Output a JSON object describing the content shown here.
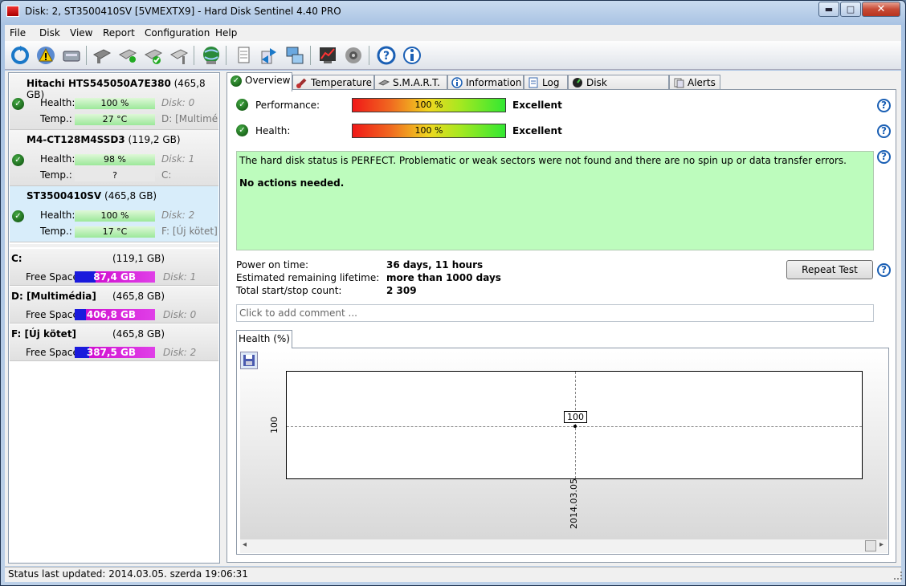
{
  "window": {
    "title": "Disk: 2, ST3500410SV [5VMEXTX9]  -  Hard Disk Sentinel 4.40 PRO",
    "controls": {
      "minimize": "▬",
      "maximize": "□",
      "close": "✕"
    }
  },
  "menu": [
    "File",
    "Disk",
    "View",
    "Report",
    "Configuration",
    "Help"
  ],
  "toolbar_icons": [
    "refresh-icon",
    "alert-icon",
    "disk-icon",
    "disk-gray-icon",
    "disk-check-icon",
    "disk-ok-icon",
    "disk-tool-icon",
    "globe-icon",
    "document-icon",
    "transfer-icon",
    "network-icon",
    "chart-icon",
    "speaker-icon",
    "help-icon",
    "info-icon"
  ],
  "disks": [
    {
      "name": "Hitachi HTS545050A7E380",
      "size": "(465,8 GB)",
      "health_label": "Health:",
      "health": "100 %",
      "health_pct": 100,
      "disk_no": "Disk: 0",
      "temp_label": "Temp.:",
      "temp": "27 °C",
      "volume": "D: [Multiméd"
    },
    {
      "name": "M4-CT128M4SSD3",
      "size": "(119,2 GB)",
      "health_label": "Health:",
      "health": "98 %",
      "health_pct": 98,
      "disk_no": "Disk: 1",
      "temp_label": "Temp.:",
      "temp": "?",
      "volume": "C:"
    },
    {
      "name": "ST3500410SV",
      "size": "(465,8 GB)",
      "health_label": "Health:",
      "health": "100 %",
      "health_pct": 100,
      "disk_no": "Disk: 2",
      "temp_label": "Temp.:",
      "temp": "17 °C",
      "volume": "F: [Új kötet]"
    }
  ],
  "volumes": [
    {
      "name": "C:",
      "size": "(119,1 GB)",
      "free_label": "Free Space",
      "free": "87,4 GB",
      "disk_no": "Disk: 1"
    },
    {
      "name": "D: [Multimédia]",
      "size": "(465,8 GB)",
      "free_label": "Free Space",
      "free": "406,8 GB",
      "disk_no": "Disk: 0"
    },
    {
      "name": "F: [Új kötet]",
      "size": "(465,8 GB)",
      "free_label": "Free Space",
      "free": "387,5 GB",
      "disk_no": "Disk: 2"
    }
  ],
  "tabs": [
    "Overview",
    "Temperature",
    "S.M.A.R.T.",
    "Information",
    "Log",
    "Disk Performance",
    "Alerts"
  ],
  "overview": {
    "performance_label": "Performance:",
    "performance_value": "100 %",
    "performance_text": "Excellent",
    "health_label": "Health:",
    "health_value": "100 %",
    "health_text": "Excellent",
    "status_message": "The hard disk status is PERFECT. Problematic or weak sectors were not found and there are no spin up or data transfer errors.",
    "action_message": "No actions needed.",
    "power_on_label": "Power on time:",
    "power_on_value": "36 days, 11 hours",
    "lifetime_label": "Estimated remaining lifetime:",
    "lifetime_value": "more than 1000 days",
    "startstop_label": "Total start/stop count:",
    "startstop_value": "2 309",
    "repeat_button": "Repeat Test",
    "help_glyph": "?",
    "comment_placeholder": "Click to add comment ...",
    "health_tab": "Health (%)"
  },
  "chart_data": {
    "type": "line",
    "x": [
      "2014.03.05"
    ],
    "series": [
      {
        "values": [
          100
        ]
      }
    ],
    "ylabel": "",
    "yticks": [
      "100"
    ],
    "data_labels": [
      "100"
    ]
  },
  "statusbar": {
    "text": "Status last updated: 2014.03.05. szerda 19:06:31"
  },
  "colors": {
    "accent": "#1a5fb4",
    "ok": "#0a6a0a",
    "status_bg": "#bdfcbd"
  }
}
